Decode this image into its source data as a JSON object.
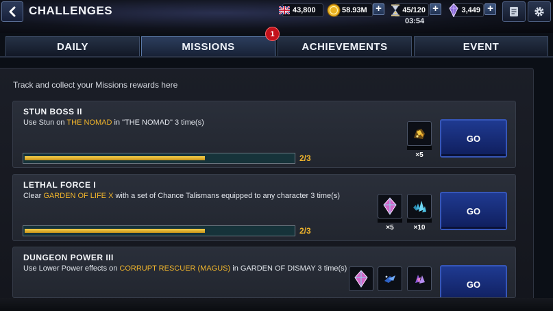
{
  "header": {
    "title": "CHALLENGES",
    "resources": [
      {
        "id": "flag",
        "value": "43,800",
        "icon": "uk-flag-icon"
      },
      {
        "id": "gold",
        "value": "58.93M",
        "icon": "gold-coin-icon"
      },
      {
        "id": "energy",
        "value": "45/120",
        "icon": "hourglass-icon"
      },
      {
        "id": "crystal",
        "value": "3,449",
        "icon": "crystal-icon"
      }
    ],
    "energy_timer": "03:54"
  },
  "tabs": [
    {
      "label": "DAILY"
    },
    {
      "label": "MISSIONS",
      "badge": "1",
      "active": true
    },
    {
      "label": "ACHIEVEMENTS"
    },
    {
      "label": "EVENT"
    }
  ],
  "content": {
    "subtitle": "Track and collect your Missions rewards here",
    "missions": [
      {
        "title": "STUN BOSS II",
        "desc_parts": [
          "Use Stun on ",
          "THE NOMAD",
          " in \"THE NOMAD\" 3 time(s)"
        ],
        "progress_text": "2/3",
        "progress": 0.667,
        "rewards": [
          {
            "icon": "gold-ore-icon",
            "qty": "×5"
          }
        ],
        "button": "GO"
      },
      {
        "title": "LETHAL FORCE I",
        "desc_parts": [
          "Clear ",
          "GARDEN OF LIFE X",
          " with a set of Chance Talismans equipped to any character 3 time(s)"
        ],
        "progress_text": "2/3",
        "progress": 0.667,
        "rewards": [
          {
            "icon": "pink-crystal-icon",
            "qty": "×5"
          },
          {
            "icon": "blue-crystal-shards-icon",
            "qty": "×10"
          }
        ],
        "button": "GO"
      },
      {
        "title": "DUNGEON POWER III",
        "desc_parts": [
          "Use Lower Power effects on ",
          "CORRUPT RESCUER (MAGUS)",
          " in GARDEN OF DISMAY 3 time(s)"
        ],
        "rewards": [
          {
            "icon": "pink-crystal-icon"
          },
          {
            "icon": "blue-crystal-shards-icon"
          },
          {
            "icon": "purple-crystal-shards-icon"
          }
        ],
        "button": "GO"
      }
    ]
  },
  "colors": {
    "accent_gold": "#f1b52c",
    "go_button": "#1f3a91",
    "badge_red": "#c3121b"
  }
}
